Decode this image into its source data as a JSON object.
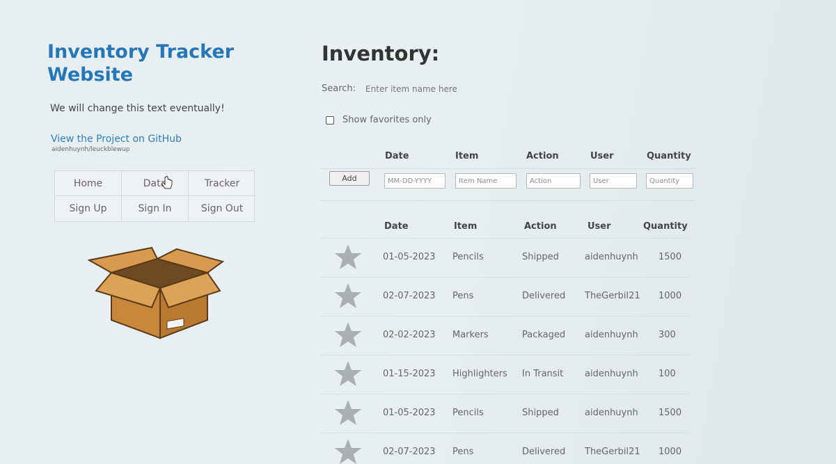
{
  "sidebar": {
    "title": "Inventory Tracker Website",
    "tagline": "We will change this text eventually!",
    "github_link": "View the Project on GitHub",
    "github_repo": "aidenhuynh/leuckblewup",
    "nav": [
      "Home",
      "Data",
      "Tracker",
      "Sign Up",
      "Sign In",
      "Sign Out"
    ]
  },
  "main": {
    "title": "Inventory:",
    "search_label": "Search:",
    "search_placeholder": "Enter item name here",
    "favorites_label": "Show favorites only",
    "headers": [
      "Date",
      "Item",
      "Action",
      "User",
      "Quantity"
    ],
    "form": {
      "add_label": "Add",
      "date_placeholder": "MM-DD-YYYY",
      "item_placeholder": "Item Name",
      "action_placeholder": "Action",
      "user_placeholder": "User",
      "quantity_placeholder": "Quantity"
    },
    "rows": [
      {
        "date": "01-05-2023",
        "item": "Pencils",
        "action": "Shipped",
        "user": "aidenhuynh",
        "quantity": "1500"
      },
      {
        "date": "02-07-2023",
        "item": "Pens",
        "action": "Delivered",
        "user": "TheGerbil21",
        "quantity": "1000"
      },
      {
        "date": "02-02-2023",
        "item": "Markers",
        "action": "Packaged",
        "user": "aidenhuynh",
        "quantity": "300"
      },
      {
        "date": "01-15-2023",
        "item": "Highlighters",
        "action": "In Transit",
        "user": "aidenhuynh",
        "quantity": "100"
      },
      {
        "date": "01-05-2023",
        "item": "Pencils",
        "action": "Shipped",
        "user": "aidenhuynh",
        "quantity": "1500"
      },
      {
        "date": "02-07-2023",
        "item": "Pens",
        "action": "Delivered",
        "user": "TheGerbil21",
        "quantity": "1000"
      }
    ]
  },
  "icons": {
    "box": "cardboard-box-icon",
    "star": "star-icon",
    "cursor": "hand-cursor-icon"
  },
  "colors": {
    "title": "#2577b8",
    "link": "#2b7fc0",
    "star": "#a9afb3",
    "box": "#c8873a"
  }
}
